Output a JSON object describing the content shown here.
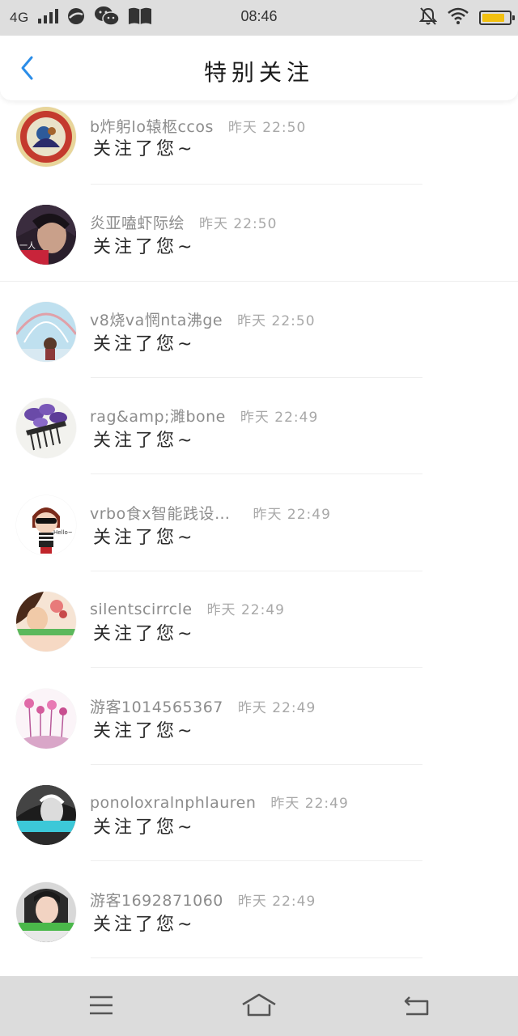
{
  "status_bar": {
    "network": "4G",
    "time": "08:46",
    "battery_level": 0.85,
    "battery_color": "#f2c010"
  },
  "header": {
    "title": "特别关注",
    "back_icon": "chevron-left-icon",
    "accent_color": "#2b8de8"
  },
  "notifications": [
    {
      "username": "b炸躬lo辕柩ccos",
      "time": "昨天 22:50",
      "message": "关注了您~"
    },
    {
      "username": "炎亚嗑虾际绘",
      "time": "昨天 22:50",
      "message": "关注了您~"
    },
    {
      "username": "v8烧va惘nta沸ge",
      "time": "昨天 22:50",
      "message": "关注了您~"
    },
    {
      "username": "rag&amp;濉bone",
      "time": "昨天 22:49",
      "message": "关注了您~"
    },
    {
      "username": "vrbo食x智能践设…",
      "time": "昨天 22:49",
      "message": "关注了您~"
    },
    {
      "username": "silentscirrcle",
      "time": "昨天 22:49",
      "message": "关注了您~"
    },
    {
      "username": "游客1014565367",
      "time": "昨天 22:49",
      "message": "关注了您~"
    },
    {
      "username": "ponoloxralnphlauren",
      "time": "昨天 22:49",
      "message": "关注了您~"
    },
    {
      "username": "游客1692871060",
      "time": "昨天 22:49",
      "message": "关注了您~"
    }
  ],
  "nav_bar": {
    "menu_icon": "menu-icon",
    "home_icon": "home-icon",
    "back_icon": "return-icon"
  }
}
